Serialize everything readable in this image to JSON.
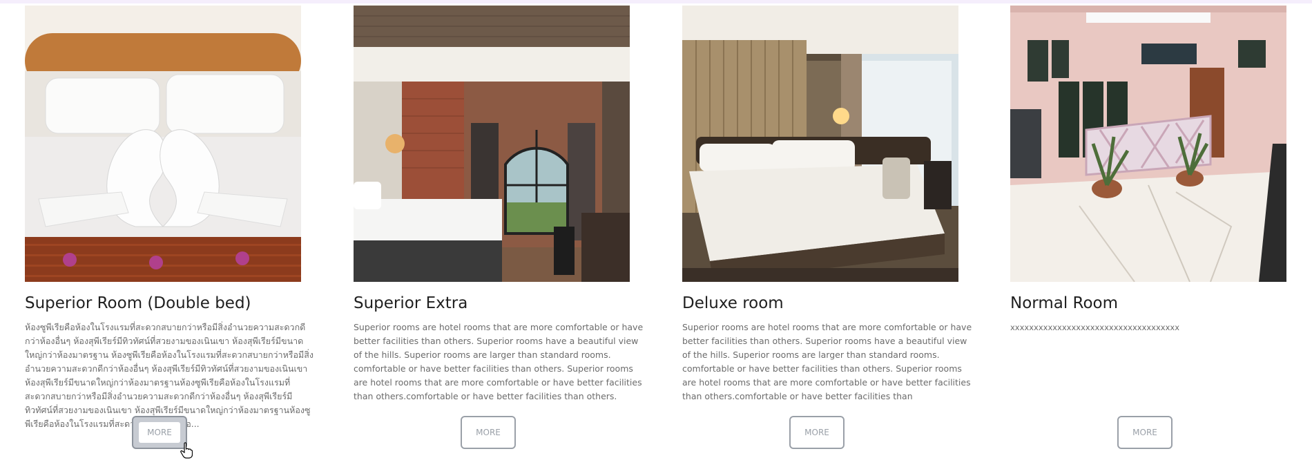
{
  "rooms": [
    {
      "title": "Superior Room (Double bed)",
      "description": "ห้องซูพีเรียคือห้องในโรงแรมที่สะดวกสบายกว่าหรือมีสิ่งอำนวยความสะดวกดีกว่าห้องอื่นๆ ห้องสุพีเรียร์มีทิวทัศน์ที่สวยงามของเนินเขา ห้องสุพีเรียร์มีขนาดใหญ่กว่าห้องมาตรฐาน ห้องซูพีเรียคือห้องในโรงแรมที่สะดวกสบายกว่าหรือมีสิ่งอำนวยความสะดวกดีกว่าห้องอื่นๆ ห้องสุพีเรียร์มีทิวทัศน์ที่สวยงามของเนินเขา ห้องสุพีเรียร์มีขนาดใหญ่กว่าห้องมาตรฐานห้องซูพีเรียคือห้องในโรงแรมที่สะดวกสบายกว่าหรือมีสิ่งอำนวยความสะดวกดีกว่าห้องอื่นๆ ห้องสุพีเรียร์มีทิวทัศน์ที่สวยงามของเนินเขา ห้องสุพีเรียร์มีขนาดใหญ่กว่าห้องมาตรฐานห้องซูพีเรียคือห้องในโรงแรมที่สะดวกสบายกว่าหรือ...",
      "more_label": "MORE"
    },
    {
      "title": "Superior Extra",
      "description": "Superior rooms are hotel rooms that are more comfortable or have better facilities than others. Superior rooms have a beautiful view of the hills. Superior rooms are larger than standard rooms. comfortable or have better facilities than others. Superior rooms are hotel rooms that are more comfortable or have better facilities than others.comfortable or have better facilities than others.",
      "more_label": "MORE"
    },
    {
      "title": "Deluxe room",
      "description": "Superior rooms are hotel rooms that are more comfortable or have better facilities than others. Superior rooms have a beautiful view of the hills. Superior rooms are larger than standard rooms. comfortable or have better facilities than others. Superior rooms are hotel rooms that are more comfortable or have better facilities than others.comfortable or have better facilities than",
      "more_label": "MORE"
    },
    {
      "title": "Normal Room",
      "description": "xxxxxxxxxxxxxxxxxxxxxxxxxxxxxxxxxxxx",
      "more_label": "MORE"
    }
  ],
  "colors": {
    "button_border": "#9aa0a8",
    "button_hover_bg": "#c7cbd2",
    "text_muted": "#6b6b6b",
    "heading": "#1f1f1f"
  }
}
